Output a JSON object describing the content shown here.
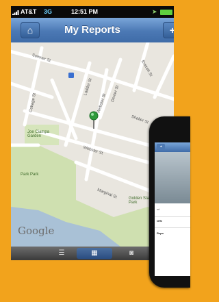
{
  "status_bar": {
    "carrier": "AT&T",
    "network": "3G",
    "time": "12:51 PM"
  },
  "nav": {
    "title": "My Reports",
    "home_icon": "⌂",
    "add_icon": "+"
  },
  "map": {
    "attribution": "Google",
    "streets": [
      "Sumner St",
      "Everett St",
      "Ladder St",
      "Webster St",
      "Dexter St",
      "Cottage St",
      "Shelter St",
      "Webster St",
      "Marginal St"
    ],
    "places": [
      "Joe Ciampa Garden",
      "Park Park",
      "Golden Stairs Park"
    ]
  },
  "tab_bar": {
    "list_icon": "☰",
    "map_icon": "▦",
    "camera_icon": "◙"
  },
  "inset_phone": {
    "lines": [
      "sd",
      "Offe",
      "Repo"
    ]
  }
}
